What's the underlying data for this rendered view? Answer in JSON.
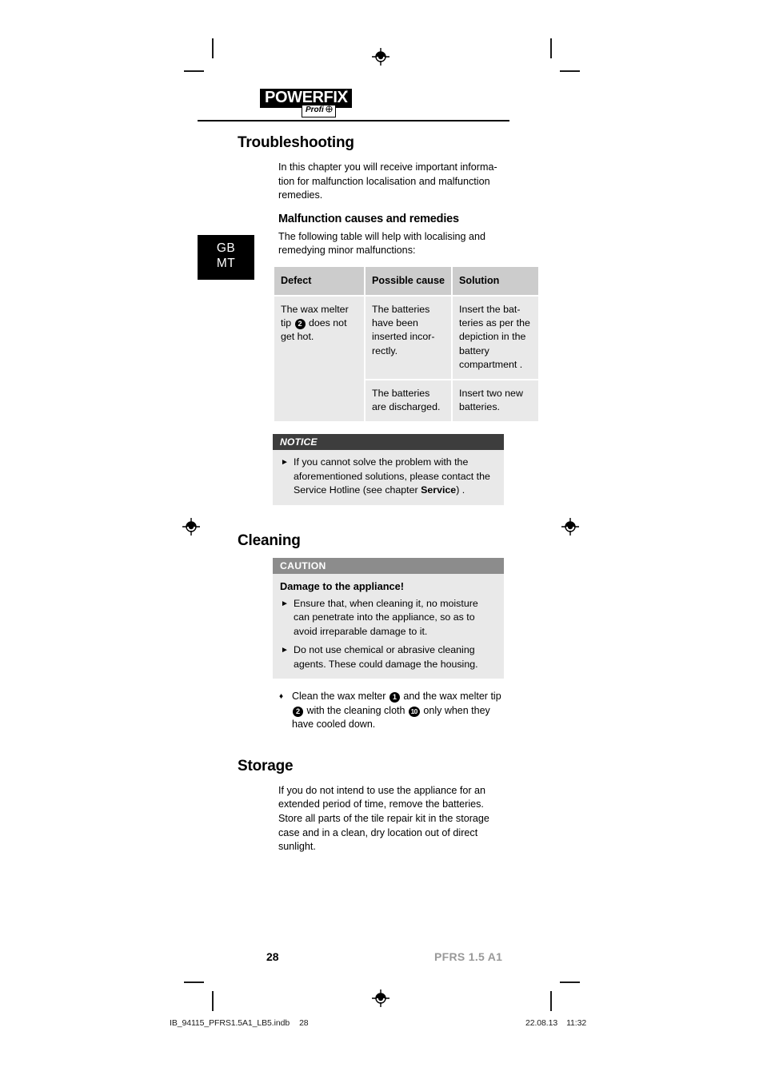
{
  "brand": {
    "name": "POWERFIX",
    "superscript": "*",
    "sub_label": "Profi",
    "sub_icon": "crosshair-circle-icon"
  },
  "language_tab": {
    "line1": "GB",
    "line2": "MT"
  },
  "sections": {
    "troubleshooting": {
      "title": "Troubleshooting",
      "intro": "In this chapter you will receive important informa-tion for malfunction localisation and malfunction remedies.",
      "subsection": {
        "title": "Malfunction causes and remedies",
        "intro": "The following table will help with localising and remedying minor malfunctions:"
      },
      "table": {
        "headers": [
          "Defect",
          "Possible cause",
          "Solution"
        ],
        "rows": [
          {
            "defect_pre": "The wax melter tip ",
            "defect_ref": "2",
            "defect_post": " does not get hot.",
            "cause": "The batteries have been inserted incor-rectly.",
            "solution": "Insert the bat-teries as per the depiction in the battery compartment ."
          },
          {
            "cause": "The batteries are discharged.",
            "solution": " Insert two new batteries."
          }
        ]
      },
      "notice": {
        "head": "NOTICE",
        "items": [
          {
            "text_pre": "If you cannot solve the problem with the aforementioned solutions, please contact the Service Hotline (see chapter ",
            "emphasis": "Service",
            "text_post": ") ."
          }
        ]
      }
    },
    "cleaning": {
      "title": "Cleaning",
      "caution": {
        "head": "CAUTION",
        "lead": "Damage to the appliance!",
        "items": [
          "Ensure that, when cleaning it, no moisture can penetrate into the appliance, so as to avoid irreparable damage to it.",
          "Do not use chemical or abrasive cleaning agents. These could damage the housing."
        ]
      },
      "steps": [
        {
          "part1": "Clean the wax melter ",
          "ref1": "1",
          "part2": " and the wax melter tip ",
          "ref2": "2",
          "part3": " with the cleaning cloth ",
          "ref3": "10",
          "part4": " only when they have cooled down."
        }
      ]
    },
    "storage": {
      "title": "Storage",
      "body": "If you do not intend to use the appliance for an extended period of time, remove the batteries. Store all parts of the tile repair kit in the storage case and in a clean, dry location out of direct sunlight."
    }
  },
  "footer": {
    "page_number": "28",
    "model": "PFRS 1.5 A1",
    "meta_file": "IB_94115_PFRS1.5A1_LB5.indb",
    "meta_file_num": "28",
    "meta_date": "22.08.13",
    "meta_time": "11:32"
  },
  "glyphs": {
    "arrow_bullet": "►",
    "diamond_bullet": "♦"
  },
  "colors": {
    "table_header_bg": "#cccccc",
    "table_cell_bg": "#e9e9e9",
    "notice_head_bg": "#3d3d3d",
    "caution_head_bg": "#8c8c8c",
    "model_text": "#999999"
  }
}
